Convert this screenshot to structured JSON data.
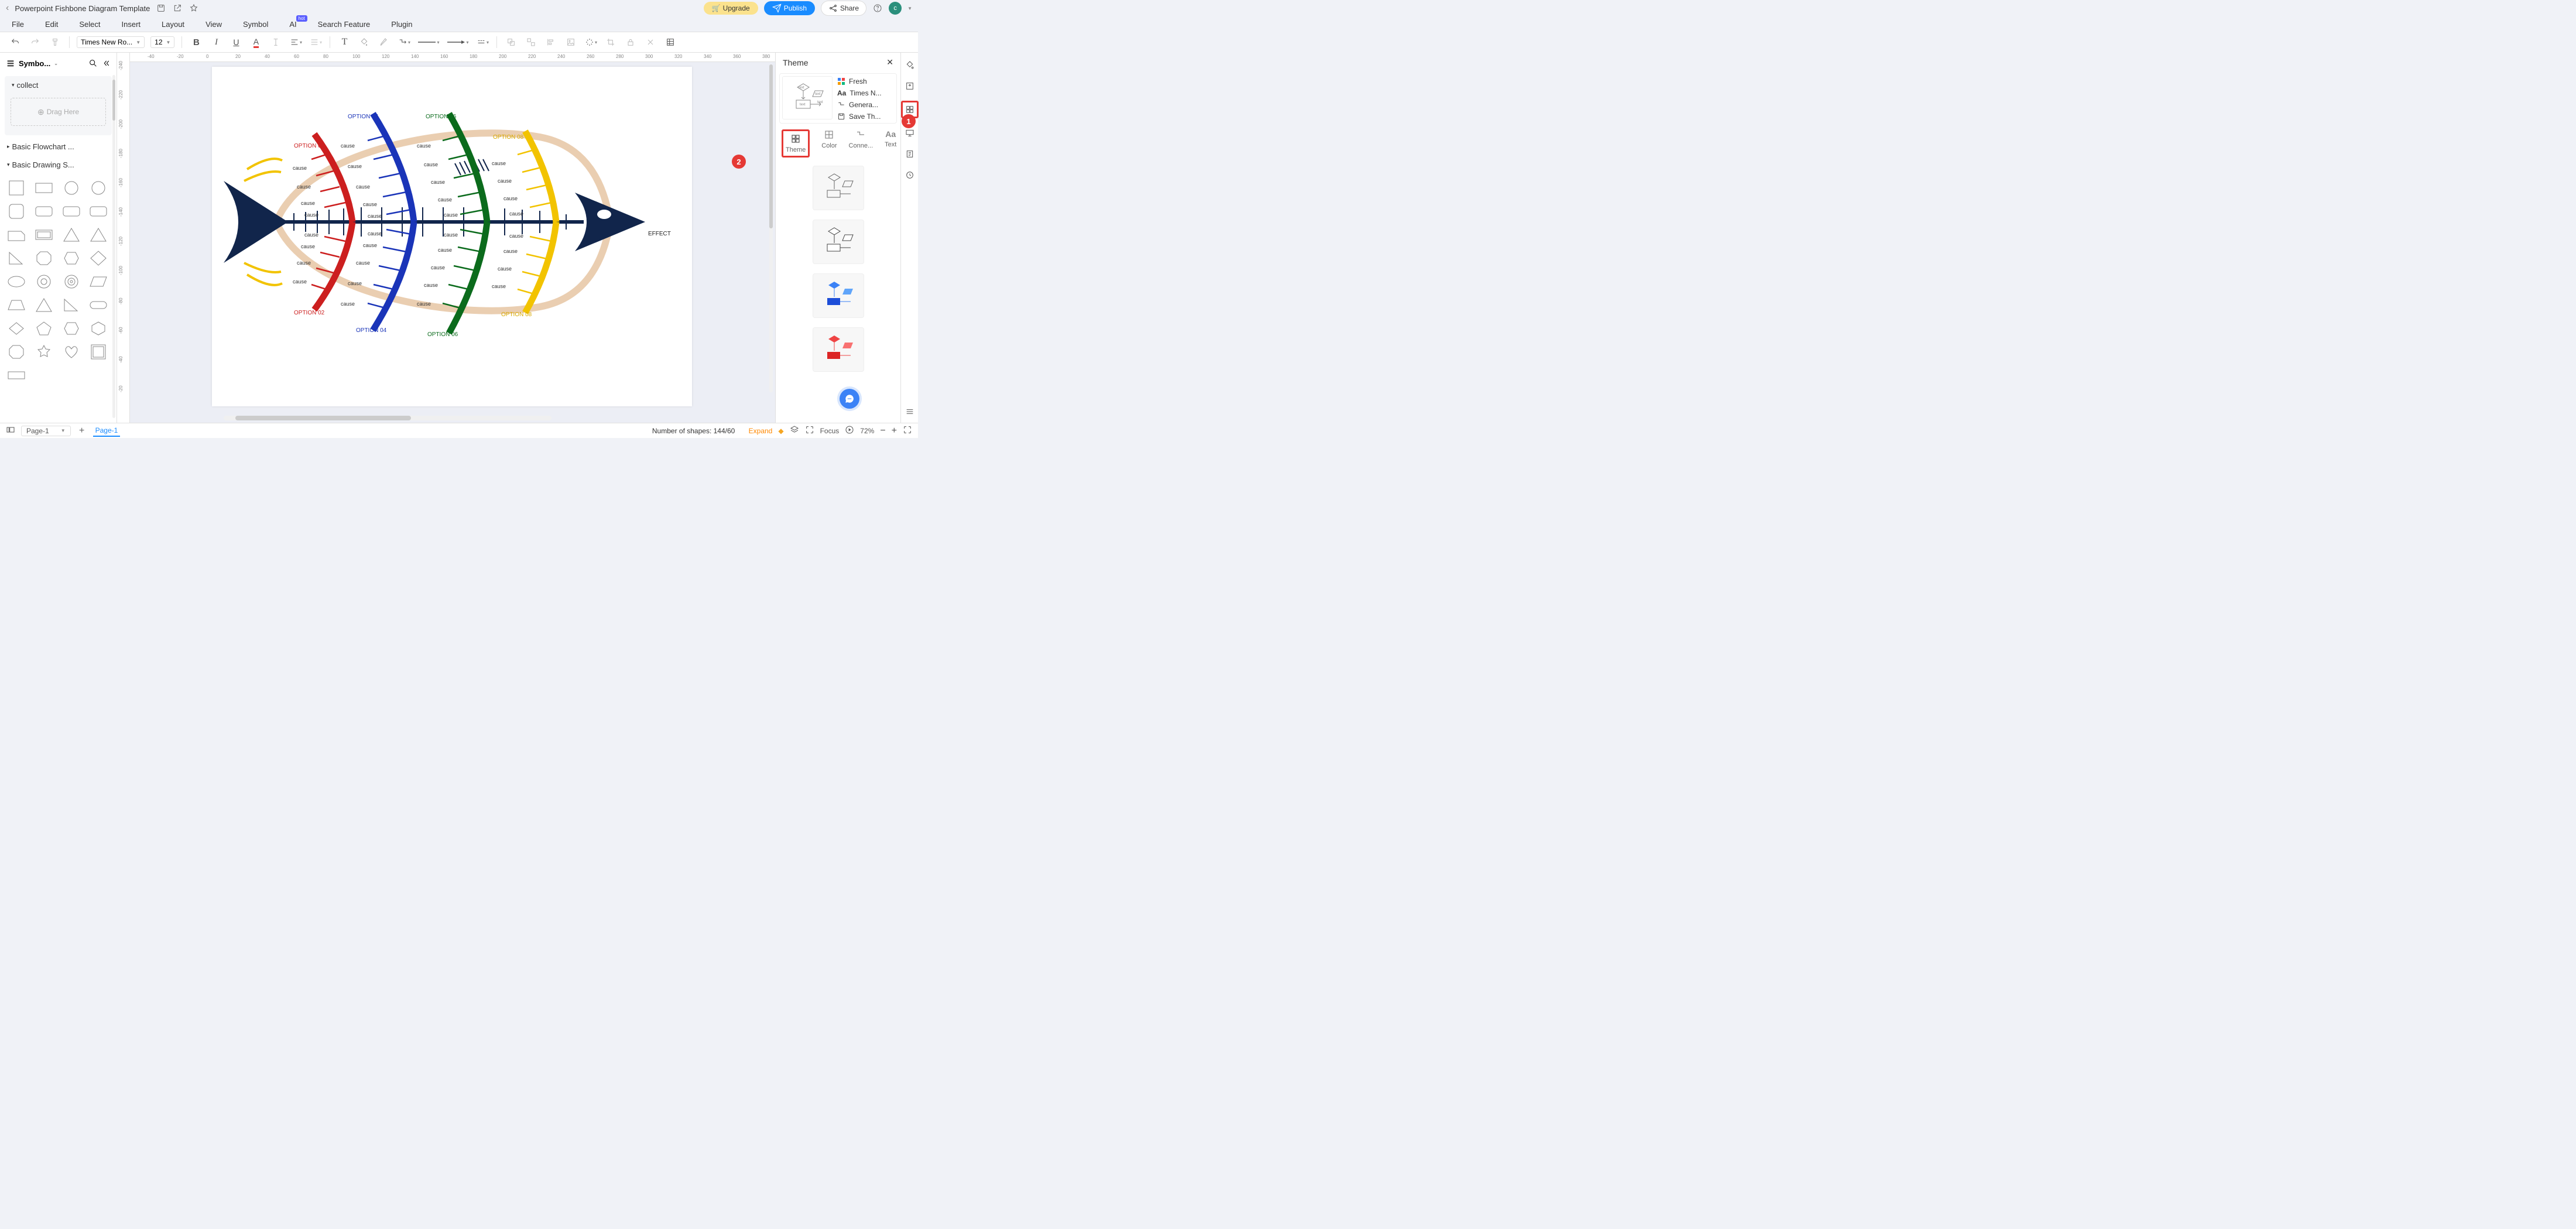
{
  "titlebar": {
    "document_name": "Powerpoint Fishbone Diagram Template",
    "upgrade": "Upgrade",
    "publish": "Publish",
    "share": "Share",
    "avatar_initial": "c"
  },
  "menu": {
    "file": "File",
    "edit": "Edit",
    "select": "Select",
    "insert": "Insert",
    "layout": "Layout",
    "view": "View",
    "symbol": "Symbol",
    "ai": "AI",
    "ai_badge": "hot",
    "search_feature": "Search Feature",
    "plugin": "Plugin"
  },
  "toolbar": {
    "font": "Times New Ro...",
    "size": "12"
  },
  "sidebar": {
    "title": "Symbo...",
    "collect": "collect",
    "drag_here": "Drag Here",
    "basic_flowchart": "Basic Flowchart ...",
    "basic_drawing": "Basic Drawing S..."
  },
  "ruler_h": [
    "-40",
    "-20",
    "0",
    "20",
    "40",
    "60",
    "80",
    "100",
    "120",
    "140",
    "160",
    "180",
    "200",
    "220",
    "240",
    "260",
    "280",
    "300",
    "320",
    "340",
    "360",
    "380"
  ],
  "ruler_v": [
    "-240",
    "-220",
    "-200",
    "-180",
    "-160",
    "-140",
    "-120",
    "-100",
    "-80",
    "-60",
    "-40",
    "-20"
  ],
  "diagram": {
    "effect": "EFFECT",
    "option02_top": "OPTION  02",
    "option04_top": "OPTION  04",
    "option06_top": "OPTION  06",
    "option08_top": "OPTION  08",
    "option02_bot": "OPTION  02",
    "option04_bot": "OPTION  04",
    "option06_bot": "OPTION  06",
    "option08_bot": "OPTION  08",
    "cause": "cause"
  },
  "rightpanel": {
    "title": "Theme",
    "fresh": "Fresh",
    "font": "Times N...",
    "connector": "Genera...",
    "save_theme": "Save Th...",
    "tab_theme": "Theme",
    "tab_color": "Color",
    "tab_conn": "Conne...",
    "tab_text": "Text"
  },
  "callouts": {
    "one": "1",
    "two": "2"
  },
  "statusbar": {
    "page_sel": "Page-1",
    "page_tab": "Page-1",
    "shapes_label": "Number of shapes: 144/60",
    "expand": "Expand",
    "focus": "Focus",
    "zoom": "72%"
  }
}
